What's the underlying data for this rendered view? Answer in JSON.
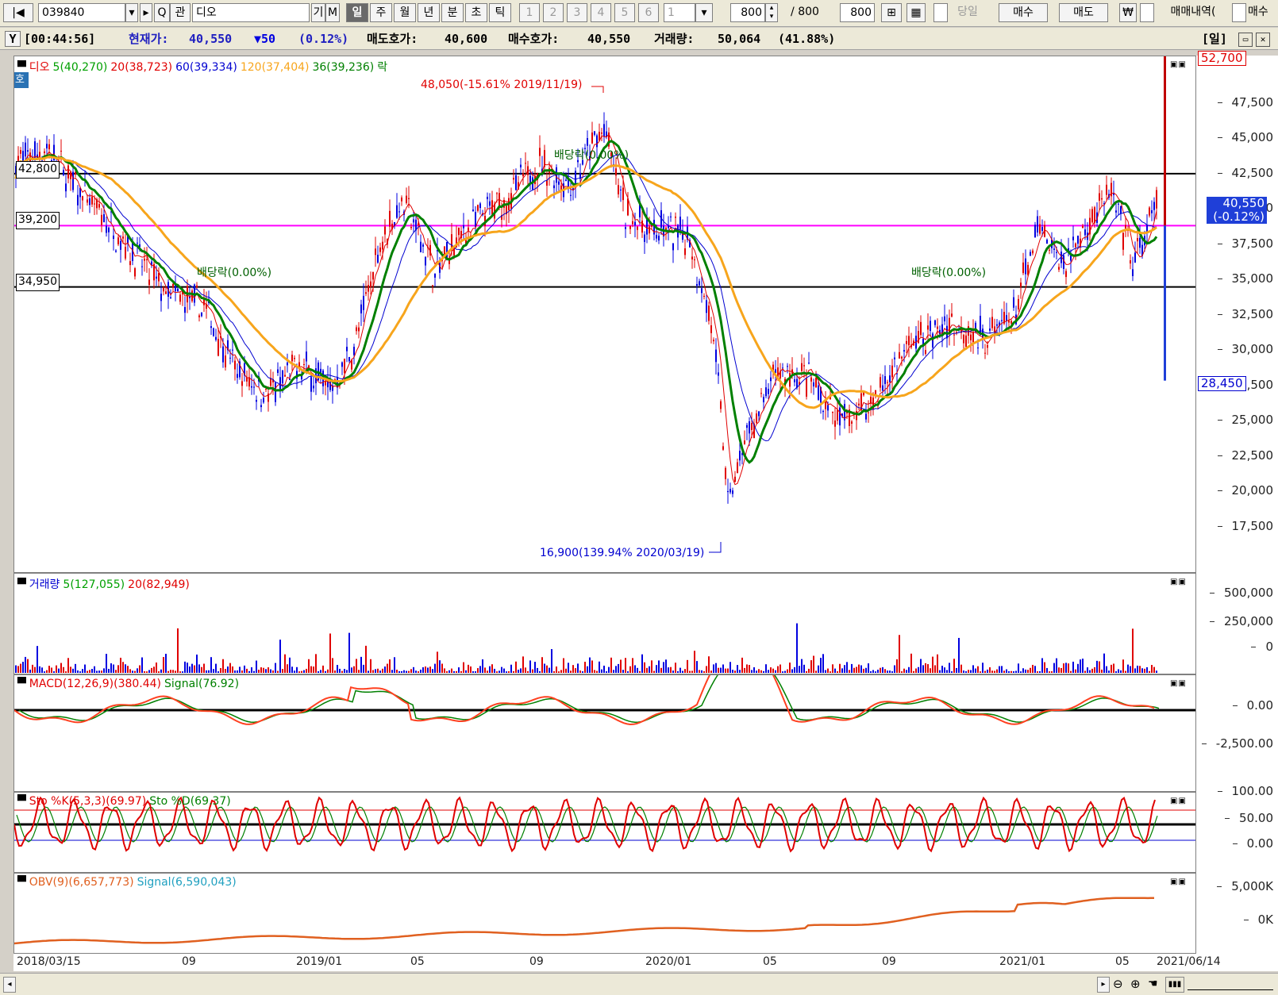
{
  "toolbar": {
    "code": "039840",
    "name": "디오",
    "btn_gi": "기",
    "btn_m": "M",
    "periods": [
      "일",
      "주",
      "월",
      "년",
      "분",
      "초",
      "틱"
    ],
    "numbers": [
      "1",
      "2",
      "3",
      "4",
      "5",
      "6"
    ],
    "count_select": "1",
    "view_count": "800",
    "total_sep": "/ 800",
    "view_count2": "800",
    "today_label": "당일",
    "buy": "매수",
    "sell": "매도",
    "won": "₩",
    "history": "매매내역(",
    "buy2": "매수"
  },
  "status": {
    "time": "[00:44:56]",
    "price_label": "현재가:",
    "price": "40,550",
    "change": "▼50",
    "change_pct": "(0.12%)",
    "ask_label": "매도호가:",
    "ask": "40,600",
    "bid_label": "매수호가:",
    "bid": "40,550",
    "vol_label": "거래량:",
    "vol": "50,064",
    "vol_pct": "(41.88%)",
    "period_tag": "[일]"
  },
  "price_panel": {
    "legend": [
      "디오",
      "5(40,270)",
      "20(38,723)",
      "60(39,334)",
      "120(37,404)",
      "36(39,236)",
      "락"
    ],
    "side_tag": "호",
    "levels": [
      "42,800",
      "39,200",
      "34,950"
    ],
    "ticks": [
      "47,500",
      "45,000",
      "42,500",
      "40,000",
      "37,500",
      "35,000",
      "32,500",
      "30,000",
      "27,500",
      "25,000",
      "22,500",
      "20,000",
      "17,500"
    ],
    "high_note": "48,050(-15.61% 2019/11/19)",
    "low_note": "16,900(139.94% 2020/03/19)",
    "dividend": [
      "배당락(0.00%)",
      "배당락(0.00%)",
      "배당락(0.00%)"
    ],
    "range_high": "52,700",
    "range_low": "28,450",
    "cur_price": "40,550",
    "cur_change": "(-0.12%)"
  },
  "volume_panel": {
    "legend": [
      "거래량",
      "5(127,055)",
      "20(82,949)"
    ],
    "ticks": [
      "500,000",
      "250,000",
      "0"
    ]
  },
  "macd_panel": {
    "legend": [
      "MACD(12,26,9)(380.44)",
      "Signal(76.92)"
    ],
    "ticks": [
      "0.00",
      "-2,500.00"
    ]
  },
  "sto_panel": {
    "legend": [
      "Sto %K(5,3,3)(69.97)",
      "Sto %D(69.37)"
    ],
    "ticks": [
      "100.00",
      "50.00",
      "0.00"
    ]
  },
  "obv_panel": {
    "legend": [
      "OBV(9)(6,657,773)",
      "Signal(6,590,043)"
    ],
    "ticks": [
      "5,000K",
      "0K"
    ]
  },
  "xaxis": [
    "2018/03/15",
    "09",
    "2019/01",
    "05",
    "09",
    "2020/01",
    "05",
    "09",
    "2021/01",
    "05",
    "2021/06/14"
  ],
  "colors": {
    "up": "#e00000",
    "down": "#0000e0",
    "ma5": "#e00000",
    "ma20": "#0000d0",
    "ma60": "#008000",
    "ma120": "#f7a51c",
    "level": "#000000",
    "magenta": "#ff00ff"
  }
}
